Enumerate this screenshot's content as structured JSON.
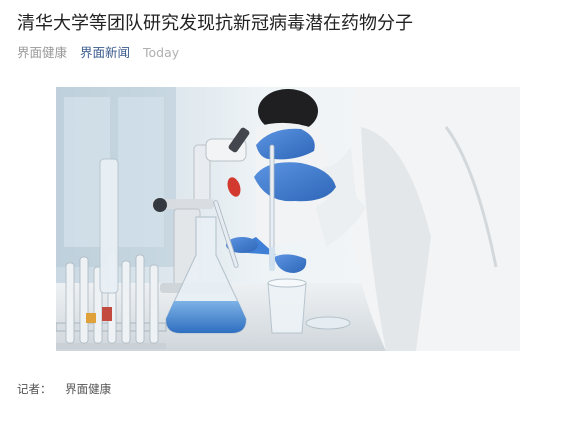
{
  "article": {
    "title": "清华大学等团队研究发现抗新冠病毒潜在药物分子",
    "source": "界面健康",
    "channel": "界面新闻",
    "date": "Today"
  },
  "byline": {
    "label": "记者：",
    "author": "界面健康"
  },
  "colors": {
    "title": "#222222",
    "meta_muted": "#999999",
    "channel_link": "#3a5a8c",
    "glove_blue": "#3f7fd6"
  },
  "image": {
    "subject": "laboratory researchers in white coats and blue gloves handling pipette and glassware"
  }
}
